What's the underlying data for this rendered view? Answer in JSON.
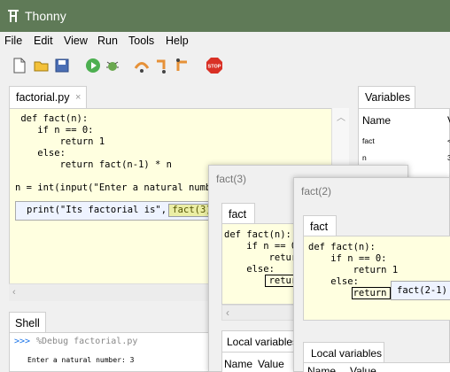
{
  "window": {
    "title": "Thonny"
  },
  "menu": [
    "File",
    "Edit",
    "View",
    "Run",
    "Tools",
    "Help"
  ],
  "toolbar": {
    "icons": [
      "new-file-icon",
      "open-file-icon",
      "save-icon",
      "run-icon",
      "debug-icon",
      "step-over-icon",
      "step-into-icon",
      "step-out-icon",
      "stop-icon"
    ],
    "stop_label": "STOP"
  },
  "editor": {
    "tab_label": "factorial.py",
    "tab_close": "×",
    "lines": [
      "def fact(n):",
      "    if n == 0:",
      "        return 1",
      "    else:",
      "        return fact(n-1) * n",
      "",
      "n = int(input(\"Enter a natural number",
      "print(\"Its factorial is\", fact(3))"
    ]
  },
  "shell": {
    "tab_label": "Shell",
    "prompt": ">>>",
    "command": "%Debug factorial.py",
    "output": "Enter a natural number: 3"
  },
  "variables": {
    "tab_label": "Variables",
    "header_name": "Name",
    "header_value": "V",
    "rows": [
      {
        "name": "fact",
        "value": "<"
      },
      {
        "name": "n",
        "value": "3"
      }
    ]
  },
  "frame3": {
    "title": "fact(3)",
    "tab_label": "fact",
    "lines": [
      "def fact(n):",
      "    if n == 0",
      "        retur",
      "    else:",
      "        retur"
    ],
    "locals_label": "Local variables",
    "header_name": "Name",
    "header_value": "Value"
  },
  "frame2": {
    "title": "fact(2)",
    "tab_label": "fact",
    "lines": [
      "def fact(n):",
      "    if n == 0:",
      "        return 1",
      "    else:",
      "        return"
    ],
    "popup": "fact(2-1)",
    "locals_label": "Local variables",
    "header_name": "Name",
    "header_value": "Value"
  },
  "colors": {
    "titlebar": "#5f7a57",
    "editor_bg": "#ffffe0",
    "keyword": "#7a0b7a",
    "string": "#006400",
    "highlight": "#e6e600"
  }
}
